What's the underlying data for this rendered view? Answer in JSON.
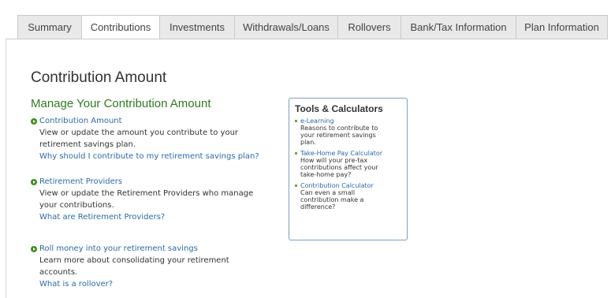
{
  "tabs": [
    {
      "label": "Summary"
    },
    {
      "label": "Contributions"
    },
    {
      "label": "Investments"
    },
    {
      "label": "Withdrawals/Loans"
    },
    {
      "label": "Rollovers"
    },
    {
      "label": "Bank/Tax Information"
    },
    {
      "label": "Plan Information"
    }
  ],
  "page_title": "Contribution Amount",
  "section_title": "Manage Your Contribution Amount",
  "items": [
    {
      "link": "Contribution Amount",
      "desc1": "View or update the amount you contribute to your",
      "desc2": "retirement savings plan.",
      "question": "Why should I contribute to my retirement savings plan?"
    },
    {
      "link": "Retirement Providers",
      "desc1": "View or update the Retirement Providers who manage",
      "desc2": "your contributions.",
      "question": "What are Retirement Providers?"
    },
    {
      "link": "Roll money into your retirement savings",
      "desc1": "Learn more about consolidating your retirement",
      "desc2": "accounts.",
      "question": "What is a rollover?"
    }
  ],
  "tools": {
    "title": "Tools & Calculators",
    "items": [
      {
        "link": "e-Learning",
        "desc": [
          "Reasons to contribute to",
          "your retirement savings",
          "plan."
        ]
      },
      {
        "link": "Take-Home Pay Calculator",
        "desc": [
          "How will your pre-tax",
          "contributions affect your",
          "take-home pay?"
        ]
      },
      {
        "link": "Contribution Calculator",
        "desc": [
          "Can even a small",
          "contribution make a",
          "difference?"
        ]
      }
    ]
  }
}
